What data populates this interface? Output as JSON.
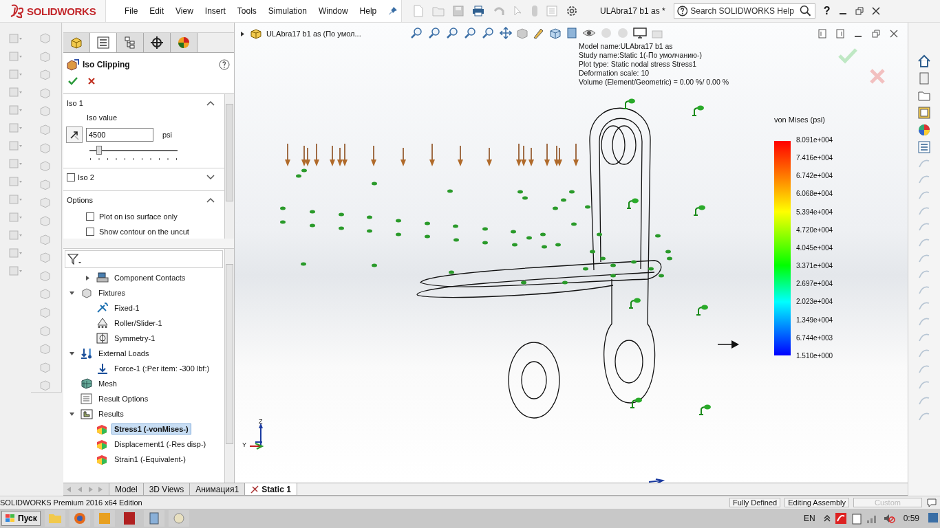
{
  "app": {
    "logo": "SOLIDWORKS",
    "menu": [
      "File",
      "Edit",
      "View",
      "Insert",
      "Tools",
      "Simulation",
      "Window",
      "Help"
    ],
    "document_title": "ULAbra17 b1 as *",
    "search": {
      "placeholder": "Search SOLIDWORKS Help"
    },
    "help": "?"
  },
  "property_manager": {
    "tabs": [
      {
        "selected": false
      },
      {
        "selected": true
      },
      {
        "selected": false
      },
      {
        "selected": false
      },
      {
        "selected": false
      }
    ],
    "title": "Iso Clipping",
    "iso1": {
      "title": "Iso 1",
      "expanded": true,
      "label": "Iso value",
      "value": "4500",
      "unit": "psi",
      "level": 0.08
    },
    "iso2": {
      "title": "Iso 2",
      "checked": false,
      "expanded": false
    },
    "options": {
      "title": "Options",
      "expanded": true,
      "items": [
        {
          "label": "Plot on iso surface only",
          "checked": false
        },
        {
          "label": "Show contour on the uncut",
          "checked": false
        }
      ]
    }
  },
  "feature_tree": {
    "continued_children": [
      {
        "label": "Component Contacts",
        "expanded": false,
        "selected": false
      }
    ],
    "items": [
      {
        "label": "Fixtures",
        "kind": "fixtures",
        "expanded": true,
        "selected": false,
        "children": [
          {
            "label": "Fixed-1",
            "kind": "fixed",
            "selected": false
          },
          {
            "label": "Roller/Slider-1",
            "kind": "roller",
            "selected": false
          },
          {
            "label": "Symmetry-1",
            "kind": "symmetry",
            "selected": false
          }
        ]
      },
      {
        "label": "External Loads",
        "kind": "loads",
        "expanded": true,
        "selected": false,
        "children": [
          {
            "label": "Force-1 (:Per item: -300 lbf:)",
            "kind": "force",
            "selected": false
          }
        ]
      },
      {
        "label": "Mesh",
        "kind": "mesh",
        "selected": false
      },
      {
        "label": "Result Options",
        "kind": "options",
        "selected": false
      },
      {
        "label": "Results",
        "kind": "results",
        "expanded": true,
        "selected": false,
        "children": [
          {
            "label": "Stress1 (-vonMises-)",
            "kind": "result",
            "selected": true
          },
          {
            "label": "Displacement1 (-Res disp-)",
            "kind": "result",
            "selected": false
          },
          {
            "label": "Strain1 (-Equivalent-)",
            "kind": "result",
            "selected": false
          }
        ]
      }
    ]
  },
  "graphics": {
    "breadcrumb": "ULAbra17 b1 as (По умол...",
    "info": [
      "Model name:ULAbra17 b1 as",
      "Study name:Static 1(-По умолчанию-)",
      "Plot type: Static nodal stress Stress1",
      "Deformation scale: 10",
      "Volume (Element/Geometric) = 0.00 %/ 0.00 %"
    ],
    "legend": {
      "title": "von Mises (psi)",
      "labels": [
        "8.091e+004",
        "7.416e+004",
        "6.742e+004",
        "6.068e+004",
        "5.394e+004",
        "4.720e+004",
        "4.045e+004",
        "3.371e+004",
        "2.697e+004",
        "2.023e+004",
        "1.349e+004",
        "6.744e+003",
        "1.510e+000"
      ]
    },
    "triad": {
      "z": "Z",
      "y": "Y"
    }
  },
  "view_tabs": [
    {
      "label": "Model",
      "selected": false
    },
    {
      "label": "3D Views",
      "selected": false
    },
    {
      "label": "Анимация1",
      "selected": false
    },
    {
      "label": "Static 1",
      "selected": true
    }
  ],
  "status_bar": {
    "edition": "SOLIDWORKS Premium 2016 x64 Edition",
    "fields": [
      {
        "label": "Fully Defined",
        "disabled": false
      },
      {
        "label": "Editing Assembly",
        "disabled": false
      },
      {
        "label": "Custom",
        "disabled": true
      }
    ]
  },
  "taskbar": {
    "start": "Пуск",
    "language": "EN",
    "time": "0:59"
  }
}
